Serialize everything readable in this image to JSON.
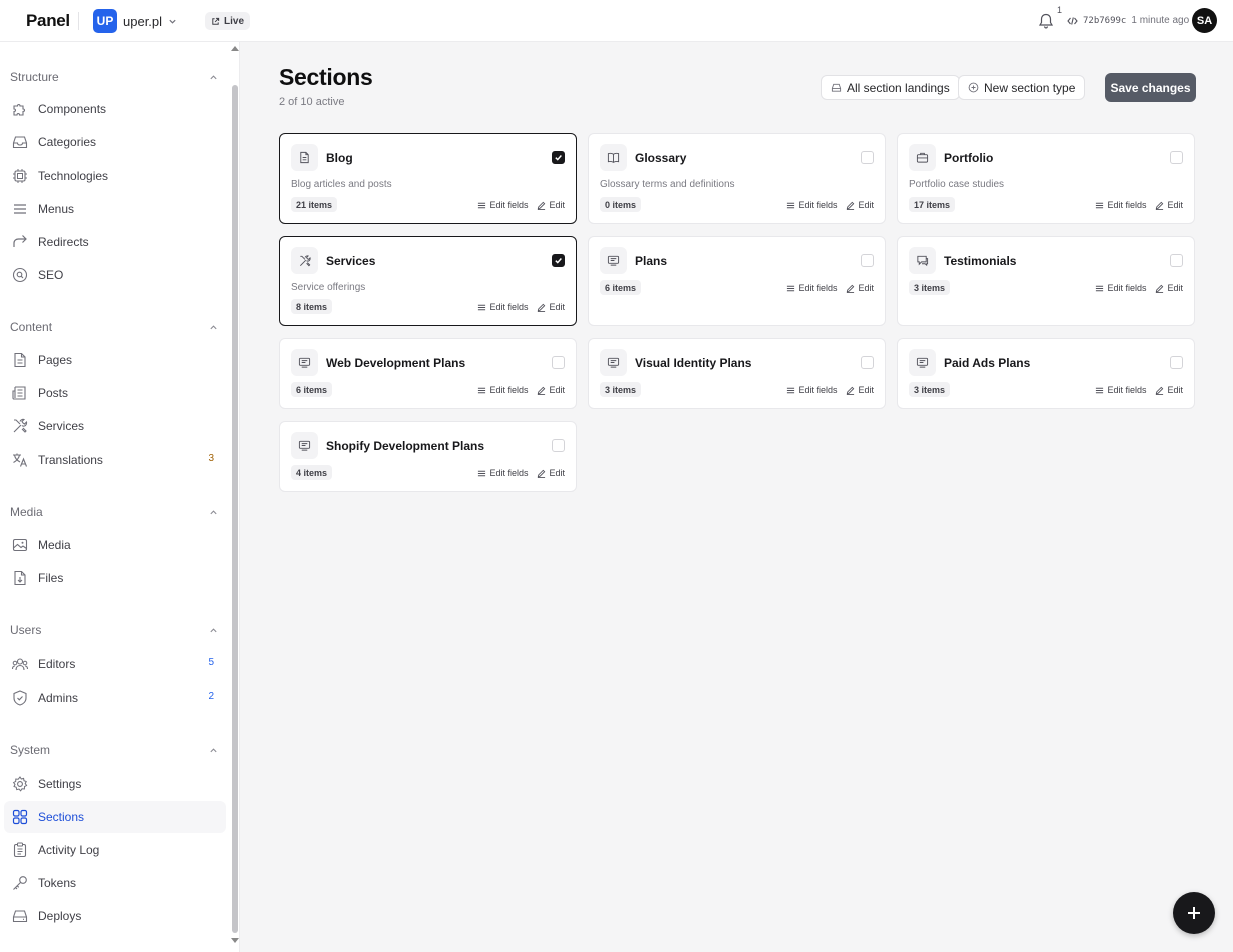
{
  "header": {
    "brand": "Panel",
    "site_initials": "UP",
    "site_name": "uper.pl",
    "live_label": "Live",
    "notification_count": "1",
    "commit_hash": "72b7699c",
    "commit_time": "1 minute ago",
    "user_initials": "SA"
  },
  "sidebar": {
    "groups": [
      {
        "title": "Structure",
        "items": [
          {
            "label": "Components",
            "icon": "puzzle-icon"
          },
          {
            "label": "Categories",
            "icon": "inbox-icon"
          },
          {
            "label": "Technologies",
            "icon": "cpu-icon"
          },
          {
            "label": "Menus",
            "icon": "menu-icon"
          },
          {
            "label": "Redirects",
            "icon": "redirect-icon"
          },
          {
            "label": "SEO",
            "icon": "seo-icon"
          }
        ]
      },
      {
        "title": "Content",
        "items": [
          {
            "label": "Pages",
            "icon": "page-icon"
          },
          {
            "label": "Posts",
            "icon": "newspaper-icon"
          },
          {
            "label": "Services",
            "icon": "tools-icon"
          },
          {
            "label": "Translations",
            "icon": "translate-icon",
            "badge": "3"
          }
        ]
      },
      {
        "title": "Media",
        "items": [
          {
            "label": "Media",
            "icon": "image-icon"
          },
          {
            "label": "Files",
            "icon": "file-download-icon"
          }
        ]
      },
      {
        "title": "Users",
        "items": [
          {
            "label": "Editors",
            "icon": "users-icon",
            "badge": "5"
          },
          {
            "label": "Admins",
            "icon": "shield-icon",
            "badge": "2"
          }
        ]
      },
      {
        "title": "System",
        "items": [
          {
            "label": "Settings",
            "icon": "gear-icon"
          },
          {
            "label": "Sections",
            "icon": "grid-icon",
            "active": true
          },
          {
            "label": "Activity Log",
            "icon": "clipboard-icon"
          },
          {
            "label": "Tokens",
            "icon": "key-icon"
          },
          {
            "label": "Deploys",
            "icon": "drive-icon"
          }
        ]
      }
    ]
  },
  "main": {
    "title": "Sections",
    "subtitle": "2 of 10 active",
    "all_landings_label": "All section landings",
    "new_type_label": "New section type",
    "save_label": "Save changes",
    "edit_fields_label": "Edit fields",
    "edit_label": "Edit",
    "cards": [
      {
        "title": "Blog",
        "description": "Blog articles and posts",
        "count": "21 items",
        "checked": true,
        "icon": "document-icon"
      },
      {
        "title": "Glossary",
        "description": "Glossary terms and definitions",
        "count": "0 items",
        "checked": false,
        "icon": "book-icon"
      },
      {
        "title": "Portfolio",
        "description": "Portfolio case studies",
        "count": "17 items",
        "checked": false,
        "icon": "briefcase-icon"
      },
      {
        "title": "Services",
        "description": "Service offerings",
        "count": "8 items",
        "checked": true,
        "icon": "tools-icon"
      },
      {
        "title": "Plans",
        "description": "",
        "count": "6 items",
        "checked": false,
        "icon": "monitor-icon"
      },
      {
        "title": "Testimonials",
        "description": "",
        "count": "3 items",
        "checked": false,
        "icon": "chat-icon"
      },
      {
        "title": "Web Development Plans",
        "description": "",
        "count": "6 items",
        "checked": false,
        "icon": "monitor-icon"
      },
      {
        "title": "Visual Identity Plans",
        "description": "",
        "count": "3 items",
        "checked": false,
        "icon": "monitor-icon"
      },
      {
        "title": "Paid Ads Plans",
        "description": "",
        "count": "3 items",
        "checked": false,
        "icon": "monitor-icon"
      },
      {
        "title": "Shopify Development Plans",
        "description": "",
        "count": "4 items",
        "checked": false,
        "icon": "monitor-icon"
      }
    ]
  },
  "colors": {
    "accent": "#1d4ed8",
    "site_avatar": "#2563eb",
    "save_button": "#565b66",
    "badge_yellow": "#a16207",
    "badge_blue": "#2563eb"
  }
}
